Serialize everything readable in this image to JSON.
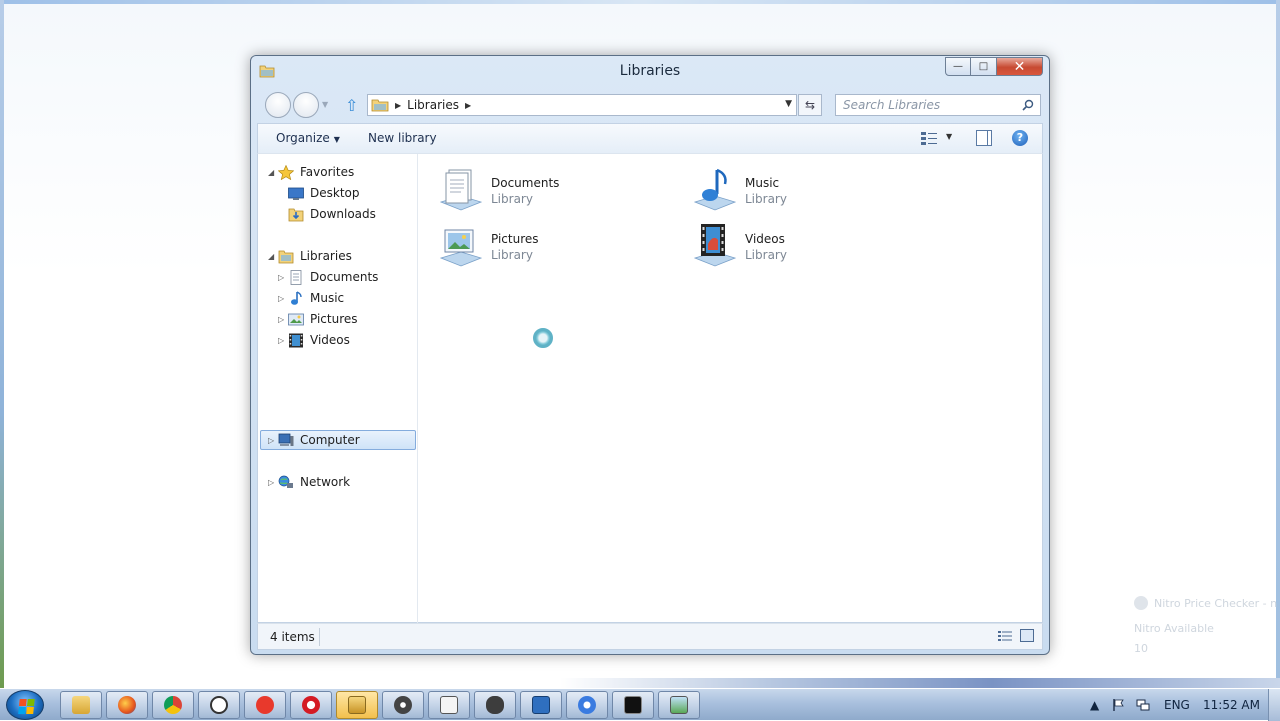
{
  "window": {
    "title": "Libraries",
    "caption": {
      "minimize": "—",
      "maximize": "□",
      "close": "✕"
    }
  },
  "address": {
    "path": [
      "Libraries"
    ],
    "search_placeholder": "Search Libraries"
  },
  "toolbar": {
    "organize": "Organize",
    "new_library": "New library"
  },
  "nav_pane": {
    "favorites": {
      "label": "Favorites",
      "items": [
        "Desktop",
        "Downloads"
      ]
    },
    "libraries": {
      "label": "Libraries",
      "items": [
        "Documents",
        "Music",
        "Pictures",
        "Videos"
      ]
    },
    "computer": "Computer",
    "network": "Network",
    "selected": "Computer"
  },
  "content": {
    "libraries": [
      {
        "name": "Documents",
        "type": "Library",
        "icon": "documents-library-icon"
      },
      {
        "name": "Music",
        "type": "Library",
        "icon": "music-library-icon"
      },
      {
        "name": "Pictures",
        "type": "Library",
        "icon": "pictures-library-icon"
      },
      {
        "name": "Videos",
        "type": "Library",
        "icon": "videos-library-icon"
      }
    ]
  },
  "status": {
    "item_count": "4 items"
  },
  "notification": {
    "line1": "Nitro Price Checker - n",
    "line2": "Nitro Available",
    "line3": "10"
  },
  "taskbar": {
    "apps": [
      "explorer",
      "firefox",
      "chrome",
      "yandex-browser",
      "yandex",
      "opera",
      "explorer-active",
      "raccoon-app",
      "notepad-app",
      "gamepad-app",
      "remote-desktop",
      "chrome-alt",
      "command-prompt",
      "image-viewer"
    ],
    "language": "ENG",
    "time": "11:52 AM"
  },
  "colors": {
    "accent": "#3d8fd8",
    "selection": "#cfe3f8",
    "close_button": "#c74a32"
  }
}
